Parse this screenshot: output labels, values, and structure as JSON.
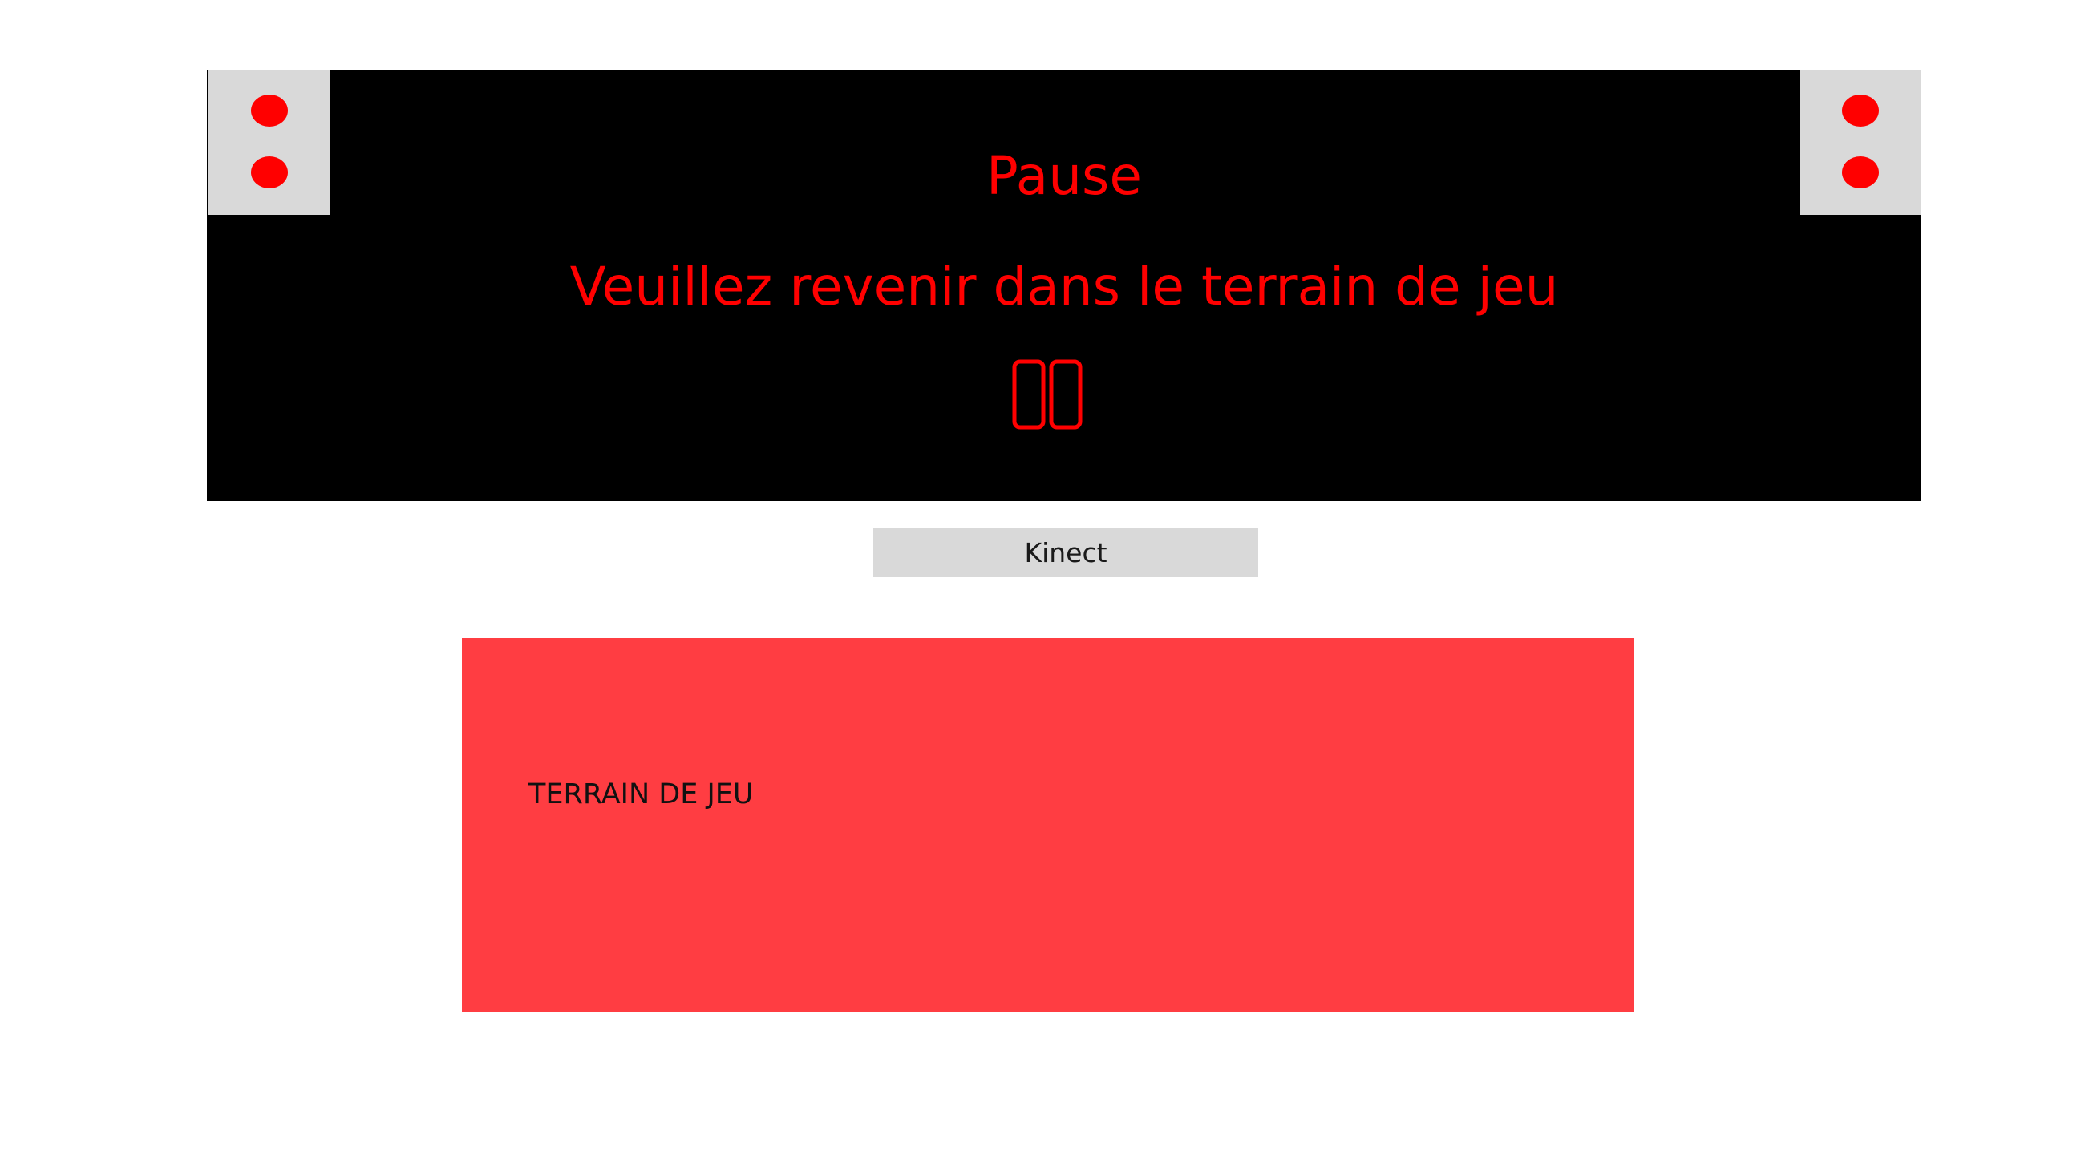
{
  "pause_screen": {
    "title": "Pause",
    "message": "Veuillez revenir dans le terrain de jeu",
    "icon": "pause-icon",
    "background_color": "#000000",
    "text_color": "#ff0000",
    "corner_color": "#d9d9d9",
    "corners": [
      {
        "name": "left",
        "dots": 2
      },
      {
        "name": "right",
        "dots": 2
      }
    ]
  },
  "kinect_button": {
    "label": "Kinect"
  },
  "terrain": {
    "label": "TERRAIN DE JEU",
    "color": "#ff3d42"
  }
}
